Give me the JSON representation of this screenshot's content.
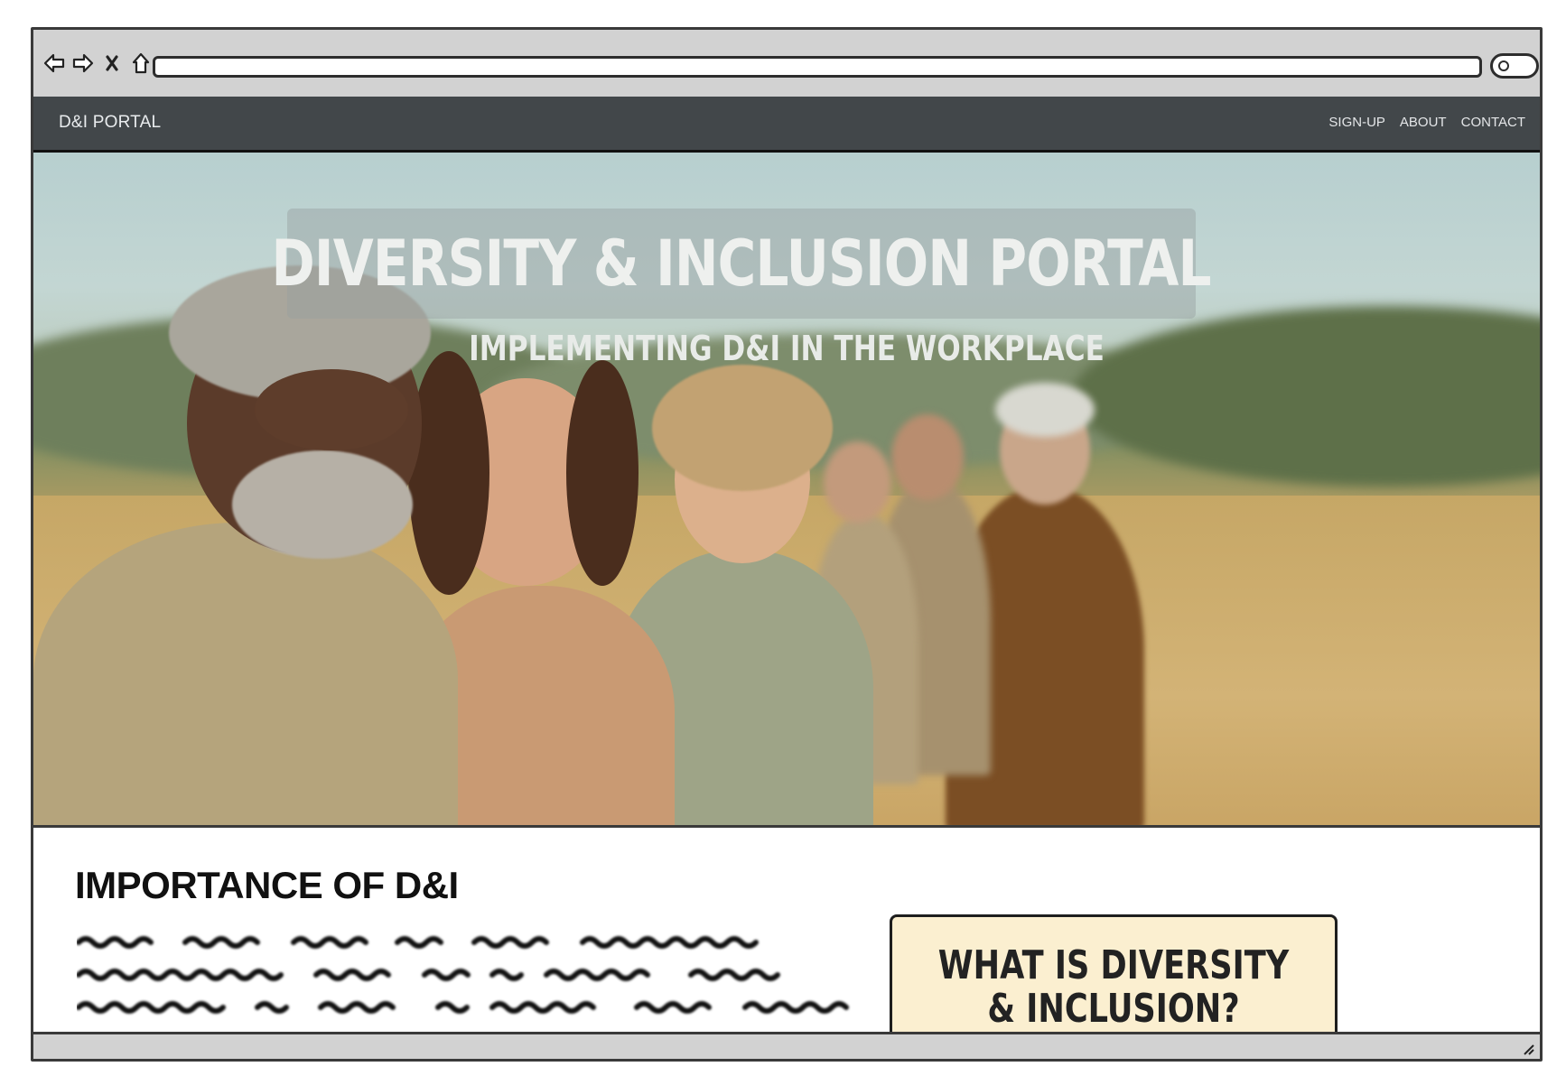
{
  "browser": {
    "back_icon": "back-arrow-icon",
    "forward_icon": "forward-arrow-icon",
    "stop_icon": "close-icon",
    "home_icon": "home-icon",
    "search_icon": "search-icon"
  },
  "navbar": {
    "brand": "D&I PORTAL",
    "links": [
      {
        "label": "SIGN-UP"
      },
      {
        "label": "ABOUT"
      },
      {
        "label": "CONTACT"
      }
    ],
    "bg_color": "#42474a"
  },
  "hero": {
    "title": "DIVERSITY & INCLUSION PORTAL",
    "subtitle": "IMPLEMENTING D&I IN THE WORKPLACE"
  },
  "section": {
    "title": "IMPORTANCE OF D&I"
  },
  "callout": {
    "title": "WHAT IS DIVERSITY & INCLUSION?",
    "bg_color": "#fbefd0"
  }
}
